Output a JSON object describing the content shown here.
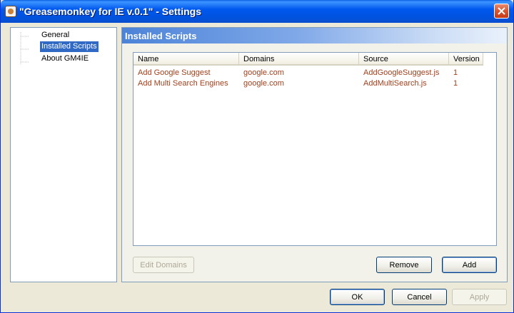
{
  "window": {
    "title": "\"Greasemonkey for IE v.0.1\" - Settings"
  },
  "nav": {
    "items": [
      {
        "label": "General",
        "selected": false
      },
      {
        "label": "Installed Scripts",
        "selected": true
      },
      {
        "label": "About GM4IE",
        "selected": false
      }
    ]
  },
  "panel": {
    "title": "Installed Scripts"
  },
  "scripts_table": {
    "columns": [
      "Name",
      "Domains",
      "Source",
      "Version"
    ],
    "rows": [
      [
        "Add Google Suggest",
        "google.com",
        "AddGoogleSuggest.js",
        "1"
      ],
      [
        "Add Multi Search Engines",
        "google.com",
        "AddMultiSearch.js",
        "1"
      ]
    ]
  },
  "buttons": {
    "edit_domains": "Edit Domains",
    "remove": "Remove",
    "add": "Add",
    "ok": "OK",
    "cancel": "Cancel",
    "apply": "Apply"
  },
  "icons": {
    "app": "greasemonkey-app-icon",
    "close": "close-icon"
  },
  "colors": {
    "titlebar": "#0058ee",
    "selection": "#316ac5",
    "script_text": "#a0401c"
  }
}
